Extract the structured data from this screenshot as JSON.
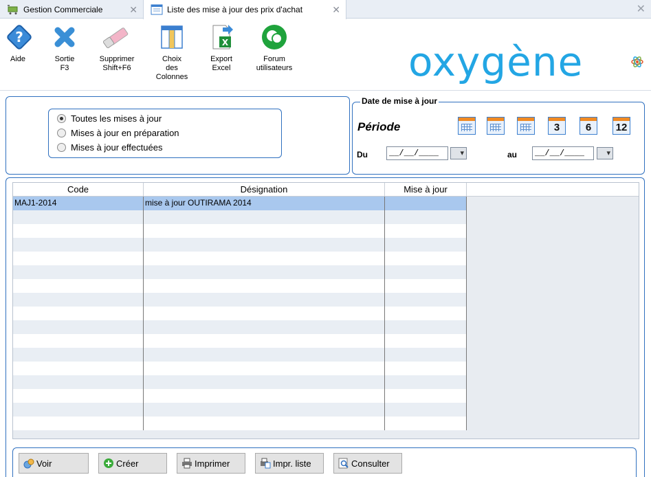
{
  "tabs": [
    {
      "label": "Gestion Commerciale",
      "close": "✕"
    },
    {
      "label": "Liste des mise à jour des prix d'achat",
      "close": "✕"
    }
  ],
  "window_close": "✕",
  "toolbar": {
    "aide": "Aide",
    "sortie": "Sortie",
    "sortie_key": "F3",
    "supprimer": "Supprimer",
    "supprimer_key": "Shift+F6",
    "choix_1": "Choix",
    "choix_2": "des",
    "choix_3": "Colonnes",
    "export_1": "Export",
    "export_2": "Excel",
    "forum_1": "Forum",
    "forum_2": "utilisateurs"
  },
  "logo": "oxygène",
  "filter": {
    "options": [
      {
        "label": "Toutes les mises à jour",
        "checked": true
      },
      {
        "label": "Mises à jour en préparation",
        "checked": false
      },
      {
        "label": "Mises à jour effectuées",
        "checked": false
      }
    ]
  },
  "date_group": {
    "legend": "Date de mise à jour",
    "periode": "Période",
    "cal_3": "3",
    "cal_6": "6",
    "cal_12": "12",
    "du_label": "Du",
    "au_label": "au",
    "du_value": "__/__/____",
    "au_value": "__/__/____"
  },
  "grid": {
    "columns": [
      "Code",
      "Désignation",
      "Mise à jour"
    ],
    "rows": [
      {
        "code": "MAJ1-2014",
        "designation": "mise à jour OUTIRAMA 2014",
        "maj": "",
        "selected": true
      }
    ]
  },
  "buttons": {
    "voir": "Voir",
    "creer": "Créer",
    "imprimer": "Imprimer",
    "impr_liste": "Impr. liste",
    "consulter": "Consulter"
  },
  "colors": {
    "accent": "#2e6fbf",
    "logo": "#23a6e4",
    "selected_row": "#a9c8ee"
  }
}
